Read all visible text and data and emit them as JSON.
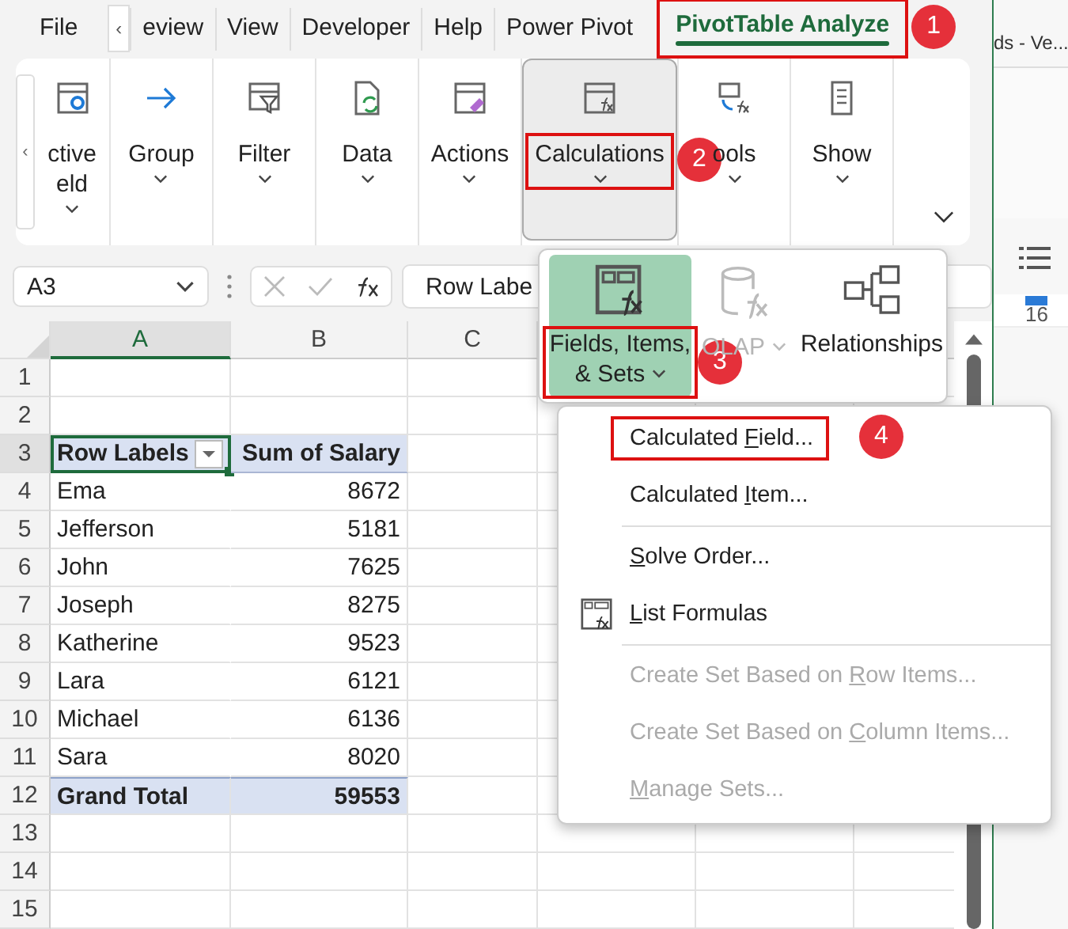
{
  "tab_bar": {
    "scroll_button": "‹",
    "tabs": [
      {
        "label": "File",
        "selected": false
      },
      {
        "label": "eview",
        "selected": false
      },
      {
        "label": "View",
        "selected": false
      },
      {
        "label": "Developer",
        "selected": false
      },
      {
        "label": "Help",
        "selected": false
      },
      {
        "label": "Power Pivot",
        "selected": false
      },
      {
        "label": "PivotTable Analyze",
        "selected": true,
        "highlighted": true,
        "badge": "1"
      }
    ]
  },
  "ribbon": {
    "scroll_button": "‹",
    "groups": [
      {
        "kind": "active-field",
        "label_lines": [
          "ctive",
          "eld"
        ],
        "selected": false
      },
      {
        "kind": "group",
        "label_lines": [
          "Group"
        ],
        "selected": false
      },
      {
        "kind": "filter",
        "label_lines": [
          "Filter"
        ],
        "selected": false
      },
      {
        "kind": "data",
        "label_lines": [
          "Data"
        ],
        "selected": false
      },
      {
        "kind": "actions",
        "label_lines": [
          "Actions"
        ],
        "selected": false
      },
      {
        "kind": "calculations",
        "label_lines": [
          "Calculations"
        ],
        "selected": true,
        "highlighted": true,
        "badge": "2"
      },
      {
        "kind": "tools",
        "label_lines": [
          "ools"
        ],
        "selected": false
      },
      {
        "kind": "show",
        "label_lines": [
          "Show"
        ],
        "selected": false
      }
    ]
  },
  "formula_bar": {
    "name_box": "A3",
    "formula": "Row Labe"
  },
  "sheet": {
    "columns": [
      {
        "label": "A",
        "selected": true
      },
      {
        "label": "B",
        "selected": false
      },
      {
        "label": "C",
        "selected": false
      }
    ],
    "rows": [
      {
        "number": "1",
        "kind": "empty",
        "selected": false
      },
      {
        "number": "2",
        "kind": "empty",
        "selected": false
      },
      {
        "number": "3",
        "kind": "header",
        "selected": true,
        "label": "Row Labels",
        "value": "Sum of Salary"
      },
      {
        "number": "4",
        "kind": "item",
        "selected": false,
        "label": "Ema",
        "value": "8672"
      },
      {
        "number": "5",
        "kind": "item",
        "selected": false,
        "label": "Jefferson",
        "value": "5181"
      },
      {
        "number": "6",
        "kind": "item",
        "selected": false,
        "label": "John",
        "value": "7625"
      },
      {
        "number": "7",
        "kind": "item",
        "selected": false,
        "label": "Joseph",
        "value": "8275"
      },
      {
        "number": "8",
        "kind": "item",
        "selected": false,
        "label": "Katherine",
        "value": "9523"
      },
      {
        "number": "9",
        "kind": "item",
        "selected": false,
        "label": "Lara",
        "value": "6121"
      },
      {
        "number": "10",
        "kind": "item",
        "selected": false,
        "label": "Michael",
        "value": "6136"
      },
      {
        "number": "11",
        "kind": "item",
        "selected": false,
        "label": "Sara",
        "value": "8020"
      },
      {
        "number": "12",
        "kind": "total",
        "selected": false,
        "label": "Grand Total",
        "value": "59553"
      },
      {
        "number": "13",
        "kind": "empty",
        "selected": false
      },
      {
        "number": "14",
        "kind": "empty",
        "selected": false
      },
      {
        "number": "15",
        "kind": "empty",
        "selected": false
      }
    ]
  },
  "calculations_menu": {
    "items": [
      {
        "kind": "fields",
        "label_lines": [
          "Fields, Items,",
          "& Sets"
        ],
        "selected": true,
        "disabled": false,
        "highlighted": true,
        "badge": "3"
      },
      {
        "kind": "olap",
        "label_lines": [
          "OLAP"
        ],
        "selected": false,
        "disabled": true
      },
      {
        "kind": "relationships",
        "label_lines": [
          "Relationships"
        ],
        "selected": false,
        "disabled": false
      }
    ]
  },
  "fields_menu": {
    "items": [
      {
        "kind": "item",
        "before": "Calculated ",
        "key": "F",
        "after": "ield...",
        "disabled": false,
        "has_icon": false,
        "highlighted": true,
        "badge": "4"
      },
      {
        "kind": "item",
        "before": "Calculated ",
        "key": "I",
        "after": "tem...",
        "disabled": false,
        "has_icon": false
      },
      {
        "kind": "separator"
      },
      {
        "kind": "item",
        "key": "S",
        "after": "olve Order...",
        "disabled": false,
        "has_icon": false
      },
      {
        "kind": "item",
        "key": "L",
        "after": "ist Formulas",
        "disabled": false,
        "has_icon": true
      },
      {
        "kind": "separator"
      },
      {
        "kind": "item",
        "before": "Create Set Based on ",
        "key": "R",
        "after": "ow Items...",
        "disabled": true,
        "has_icon": false
      },
      {
        "kind": "item",
        "before": "Create Set Based on ",
        "key": "C",
        "after": "olumn Items...",
        "disabled": true,
        "has_icon": false
      },
      {
        "kind": "item",
        "key": "M",
        "after": "anage Sets...",
        "disabled": true,
        "has_icon": false
      }
    ]
  },
  "background_window": {
    "title": "ds - Ve...",
    "ruler_mark": "16"
  }
}
